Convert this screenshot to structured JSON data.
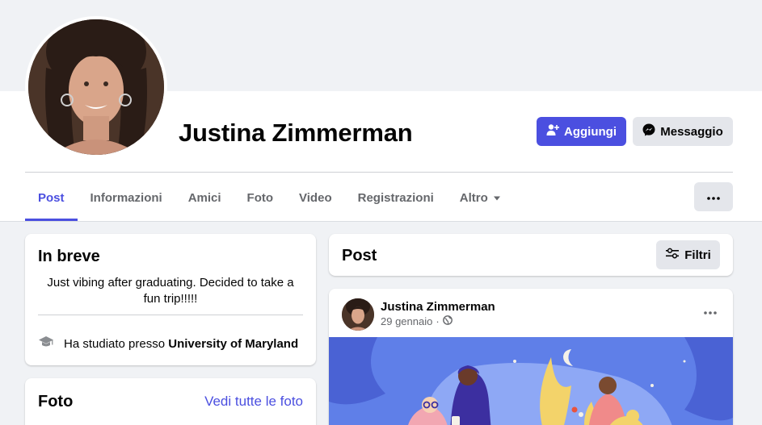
{
  "profile": {
    "name": "Justina Zimmerman"
  },
  "actions": {
    "add_label": "Aggiungi",
    "message_label": "Messaggio"
  },
  "tabs": [
    {
      "label": "Post"
    },
    {
      "label": "Informazioni"
    },
    {
      "label": "Amici"
    },
    {
      "label": "Foto"
    },
    {
      "label": "Video"
    },
    {
      "label": "Registrazioni"
    },
    {
      "label": "Altro"
    }
  ],
  "intro": {
    "title": "In breve",
    "bio": "Just vibing after graduating. Decided to take a fun trip!!!!!",
    "education_prefix": "Ha studiato presso ",
    "education_school": "University of Maryland"
  },
  "photos": {
    "title": "Foto",
    "see_all": "Vedi tutte le foto"
  },
  "posts": {
    "title": "Post",
    "filter_label": "Filtri"
  },
  "post": {
    "author": "Justina Zimmerman",
    "date": "29 gennaio",
    "separator": "·",
    "privacy_icon": "globe-icon"
  },
  "colors": {
    "accent": "#4b4fe0",
    "page_bg": "#f0f2f5",
    "secondary_button": "#e4e6eb",
    "muted_text": "#65676b"
  }
}
